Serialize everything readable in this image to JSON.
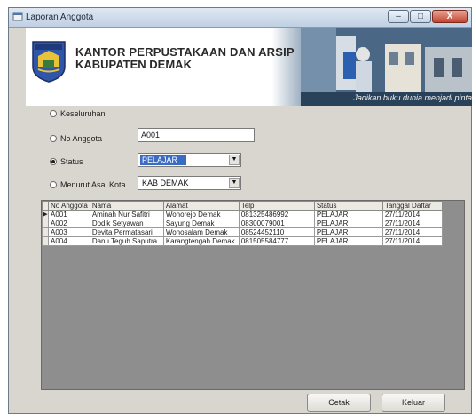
{
  "window": {
    "title": "Laporan Anggota",
    "min_label": "–",
    "max_label": "□",
    "close_label": "X"
  },
  "banner": {
    "title_line1": "KANTOR PERPUSTAKAAN DAN ARSIP",
    "title_line2": "KABUPATEN DEMAK",
    "slogan": "Jadikan buku dunia menjadi pintar"
  },
  "filters": {
    "keseluruhan": {
      "label": "Keseluruhan",
      "selected": false
    },
    "no_anggota": {
      "label": "No Anggota",
      "selected": false,
      "value": "A001"
    },
    "status": {
      "label": "Status",
      "selected": true,
      "value": "PELAJAR"
    },
    "asal_kota": {
      "label": "Menurut Asal Kota",
      "selected": false,
      "value": "KAB DEMAK"
    }
  },
  "table": {
    "columns": [
      "No Anggota",
      "Nama",
      "Alamat",
      "Telp",
      "Status",
      "Tanggal Daftar"
    ],
    "rows": [
      {
        "current": true,
        "cells": [
          "A001",
          "Aminah Nur Safitri",
          "Wonorejo Demak",
          "081325486992",
          "PELAJAR",
          "27/11/2014"
        ]
      },
      {
        "current": false,
        "cells": [
          "A002",
          "Dodik Setyawan",
          "Sayung Demak",
          "08300079001",
          "PELAJAR",
          "27/11/2014"
        ]
      },
      {
        "current": false,
        "cells": [
          "A003",
          "Devita Permatasari",
          "Wonosalam Demak",
          "08524452110",
          "PELAJAR",
          "27/11/2014"
        ]
      },
      {
        "current": false,
        "cells": [
          "A004",
          "Danu Teguh Saputra",
          "Karangtengah Demak",
          "081505584777",
          "PELAJAR",
          "27/11/2014"
        ]
      }
    ]
  },
  "buttons": {
    "print": "Cetak",
    "exit": "Keluar"
  },
  "icons": {
    "app": "app-form-icon",
    "logo": "demak-logo",
    "current_row": "row-pointer-icon",
    "dropdown": "chevron-down-icon"
  },
  "colors": {
    "selection": "#3b6cc4",
    "window_bg": "#d9d6cf",
    "title_bar": "#cfdcec"
  }
}
